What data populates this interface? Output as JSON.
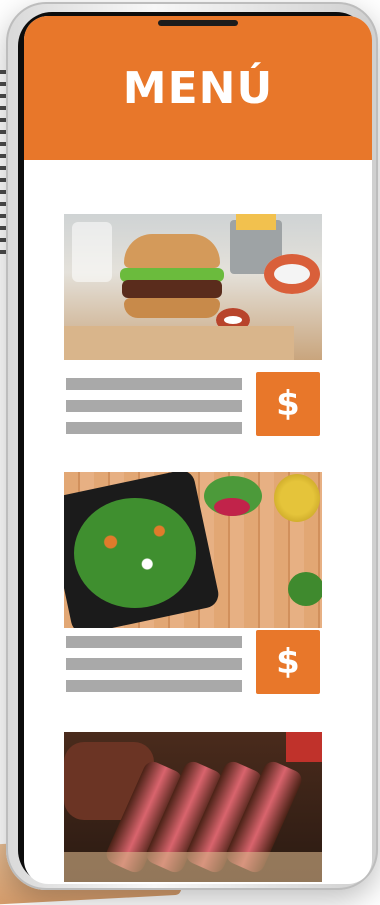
{
  "header": {
    "title": "MENÚ"
  },
  "menu_items": [
    {
      "name": "burger-item",
      "price_symbol": "$",
      "photo_icon": "burger-photo"
    },
    {
      "name": "salad-item",
      "price_symbol": "$",
      "photo_icon": "salad-photo"
    },
    {
      "name": "steak-item",
      "photo_icon": "steak-photo"
    }
  ],
  "colors": {
    "accent": "#e8772a",
    "placeholder_line": "#a9a9a9"
  }
}
